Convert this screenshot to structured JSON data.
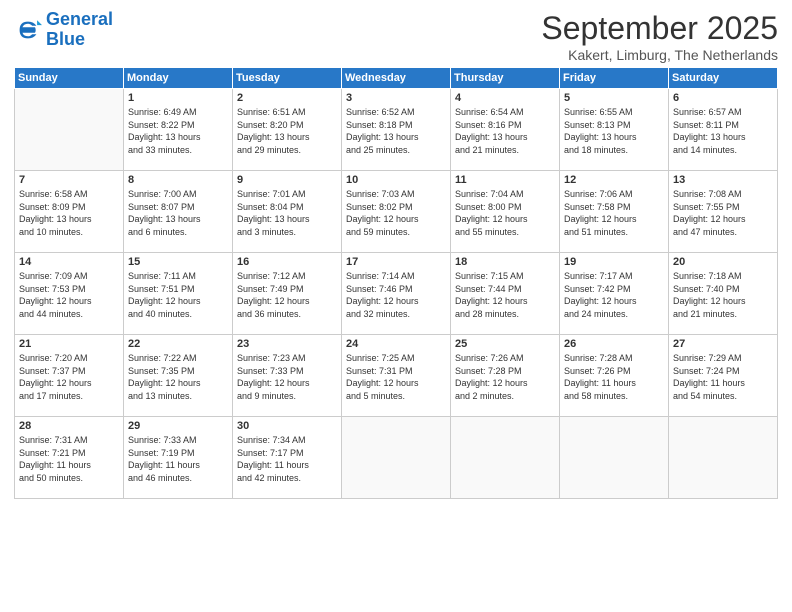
{
  "logo": {
    "line1": "General",
    "line2": "Blue"
  },
  "title": "September 2025",
  "location": "Kakert, Limburg, The Netherlands",
  "days_header": [
    "Sunday",
    "Monday",
    "Tuesday",
    "Wednesday",
    "Thursday",
    "Friday",
    "Saturday"
  ],
  "weeks": [
    [
      {
        "num": "",
        "info": ""
      },
      {
        "num": "1",
        "info": "Sunrise: 6:49 AM\nSunset: 8:22 PM\nDaylight: 13 hours\nand 33 minutes."
      },
      {
        "num": "2",
        "info": "Sunrise: 6:51 AM\nSunset: 8:20 PM\nDaylight: 13 hours\nand 29 minutes."
      },
      {
        "num": "3",
        "info": "Sunrise: 6:52 AM\nSunset: 8:18 PM\nDaylight: 13 hours\nand 25 minutes."
      },
      {
        "num": "4",
        "info": "Sunrise: 6:54 AM\nSunset: 8:16 PM\nDaylight: 13 hours\nand 21 minutes."
      },
      {
        "num": "5",
        "info": "Sunrise: 6:55 AM\nSunset: 8:13 PM\nDaylight: 13 hours\nand 18 minutes."
      },
      {
        "num": "6",
        "info": "Sunrise: 6:57 AM\nSunset: 8:11 PM\nDaylight: 13 hours\nand 14 minutes."
      }
    ],
    [
      {
        "num": "7",
        "info": "Sunrise: 6:58 AM\nSunset: 8:09 PM\nDaylight: 13 hours\nand 10 minutes."
      },
      {
        "num": "8",
        "info": "Sunrise: 7:00 AM\nSunset: 8:07 PM\nDaylight: 13 hours\nand 6 minutes."
      },
      {
        "num": "9",
        "info": "Sunrise: 7:01 AM\nSunset: 8:04 PM\nDaylight: 13 hours\nand 3 minutes."
      },
      {
        "num": "10",
        "info": "Sunrise: 7:03 AM\nSunset: 8:02 PM\nDaylight: 12 hours\nand 59 minutes."
      },
      {
        "num": "11",
        "info": "Sunrise: 7:04 AM\nSunset: 8:00 PM\nDaylight: 12 hours\nand 55 minutes."
      },
      {
        "num": "12",
        "info": "Sunrise: 7:06 AM\nSunset: 7:58 PM\nDaylight: 12 hours\nand 51 minutes."
      },
      {
        "num": "13",
        "info": "Sunrise: 7:08 AM\nSunset: 7:55 PM\nDaylight: 12 hours\nand 47 minutes."
      }
    ],
    [
      {
        "num": "14",
        "info": "Sunrise: 7:09 AM\nSunset: 7:53 PM\nDaylight: 12 hours\nand 44 minutes."
      },
      {
        "num": "15",
        "info": "Sunrise: 7:11 AM\nSunset: 7:51 PM\nDaylight: 12 hours\nand 40 minutes."
      },
      {
        "num": "16",
        "info": "Sunrise: 7:12 AM\nSunset: 7:49 PM\nDaylight: 12 hours\nand 36 minutes."
      },
      {
        "num": "17",
        "info": "Sunrise: 7:14 AM\nSunset: 7:46 PM\nDaylight: 12 hours\nand 32 minutes."
      },
      {
        "num": "18",
        "info": "Sunrise: 7:15 AM\nSunset: 7:44 PM\nDaylight: 12 hours\nand 28 minutes."
      },
      {
        "num": "19",
        "info": "Sunrise: 7:17 AM\nSunset: 7:42 PM\nDaylight: 12 hours\nand 24 minutes."
      },
      {
        "num": "20",
        "info": "Sunrise: 7:18 AM\nSunset: 7:40 PM\nDaylight: 12 hours\nand 21 minutes."
      }
    ],
    [
      {
        "num": "21",
        "info": "Sunrise: 7:20 AM\nSunset: 7:37 PM\nDaylight: 12 hours\nand 17 minutes."
      },
      {
        "num": "22",
        "info": "Sunrise: 7:22 AM\nSunset: 7:35 PM\nDaylight: 12 hours\nand 13 minutes."
      },
      {
        "num": "23",
        "info": "Sunrise: 7:23 AM\nSunset: 7:33 PM\nDaylight: 12 hours\nand 9 minutes."
      },
      {
        "num": "24",
        "info": "Sunrise: 7:25 AM\nSunset: 7:31 PM\nDaylight: 12 hours\nand 5 minutes."
      },
      {
        "num": "25",
        "info": "Sunrise: 7:26 AM\nSunset: 7:28 PM\nDaylight: 12 hours\nand 2 minutes."
      },
      {
        "num": "26",
        "info": "Sunrise: 7:28 AM\nSunset: 7:26 PM\nDaylight: 11 hours\nand 58 minutes."
      },
      {
        "num": "27",
        "info": "Sunrise: 7:29 AM\nSunset: 7:24 PM\nDaylight: 11 hours\nand 54 minutes."
      }
    ],
    [
      {
        "num": "28",
        "info": "Sunrise: 7:31 AM\nSunset: 7:21 PM\nDaylight: 11 hours\nand 50 minutes."
      },
      {
        "num": "29",
        "info": "Sunrise: 7:33 AM\nSunset: 7:19 PM\nDaylight: 11 hours\nand 46 minutes."
      },
      {
        "num": "30",
        "info": "Sunrise: 7:34 AM\nSunset: 7:17 PM\nDaylight: 11 hours\nand 42 minutes."
      },
      {
        "num": "",
        "info": ""
      },
      {
        "num": "",
        "info": ""
      },
      {
        "num": "",
        "info": ""
      },
      {
        "num": "",
        "info": ""
      }
    ]
  ]
}
